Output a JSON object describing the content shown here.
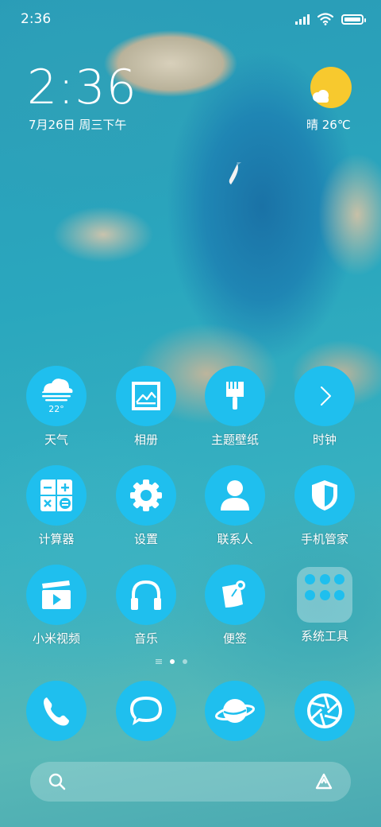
{
  "status_bar": {
    "time": "2:36"
  },
  "widget": {
    "clock": "2:36",
    "date": "7月26日 周三下午",
    "weather": "晴 26℃"
  },
  "apps": [
    {
      "name": "weather-app",
      "label": "天气",
      "icon": "weather-cloud-icon",
      "badge": "22°"
    },
    {
      "name": "gallery-app",
      "label": "相册",
      "icon": "gallery-icon"
    },
    {
      "name": "themes-app",
      "label": "主题壁纸",
      "icon": "brush-icon"
    },
    {
      "name": "clock-app",
      "label": "时钟",
      "icon": "chevron-right-icon"
    },
    {
      "name": "calculator-app",
      "label": "计算器",
      "icon": "calculator-icon"
    },
    {
      "name": "settings-app",
      "label": "设置",
      "icon": "gear-icon"
    },
    {
      "name": "contacts-app",
      "label": "联系人",
      "icon": "person-icon"
    },
    {
      "name": "security-app",
      "label": "手机管家",
      "icon": "shield-icon"
    },
    {
      "name": "video-app",
      "label": "小米视频",
      "icon": "video-clapper-icon"
    },
    {
      "name": "music-app",
      "label": "音乐",
      "icon": "headphones-icon"
    },
    {
      "name": "notes-app",
      "label": "便签",
      "icon": "note-pin-icon"
    },
    {
      "name": "tools-folder",
      "label": "系统工具",
      "icon": "folder-icon"
    }
  ],
  "dock": [
    {
      "name": "phone-app",
      "icon": "phone-icon"
    },
    {
      "name": "messages-app",
      "icon": "message-bubble-icon"
    },
    {
      "name": "browser-app",
      "icon": "planet-icon"
    },
    {
      "name": "camera-app",
      "icon": "camera-shutter-icon"
    }
  ],
  "pager": {
    "pages": 2,
    "current": 1
  },
  "colors": {
    "icon_bg": "#1fbfee",
    "sun": "#f7c92e"
  }
}
